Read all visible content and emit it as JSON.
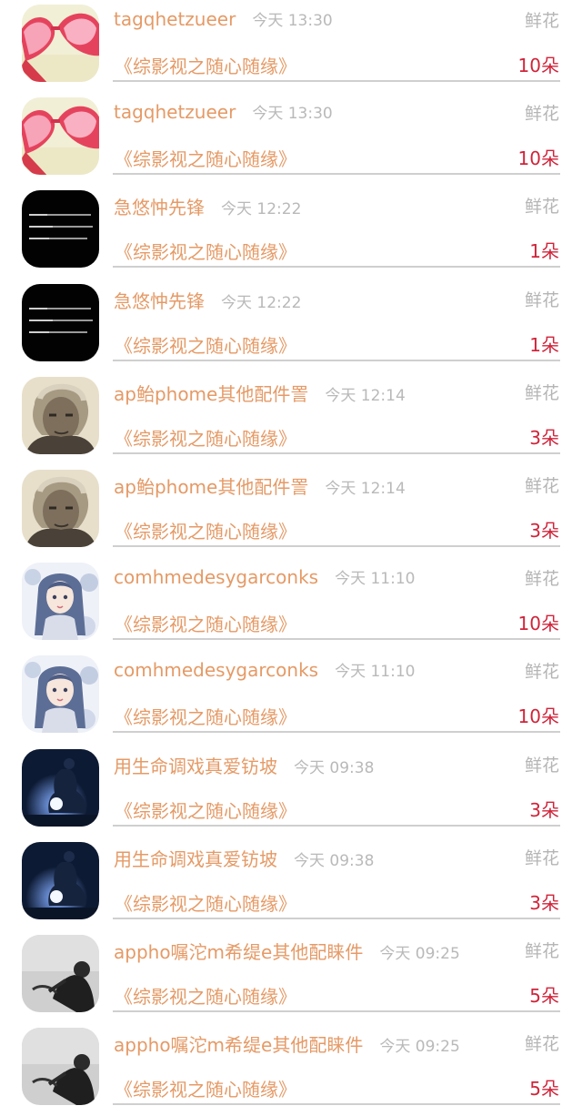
{
  "colors": {
    "name": "#e59a66",
    "time": "#b9b9b9",
    "gift_type": "#b5b5b5",
    "count": "#d0243a",
    "divider": "#cfcfcf"
  },
  "rows": [
    {
      "name": "tagqhetzueer",
      "time": "今天 13:30",
      "gift_type": "鲜花",
      "book": "《综影视之随心随缘》",
      "count": "10朵",
      "avatar": "heart-sunglasses-avatar"
    },
    {
      "name": "tagqhetzueer",
      "time": "今天 13:30",
      "gift_type": "鲜花",
      "book": "《综影视之随心随缘》",
      "count": "10朵",
      "avatar": "heart-sunglasses-avatar"
    },
    {
      "name": "急悠忡先锋",
      "time": "今天 12:22",
      "gift_type": "鲜花",
      "book": "《综影视之随心随缘》",
      "count": "1朵",
      "avatar": "text-quote-avatar"
    },
    {
      "name": "急悠忡先锋",
      "time": "今天 12:22",
      "gift_type": "鲜花",
      "book": "《综影视之随心随缘》",
      "count": "1朵",
      "avatar": "text-quote-avatar"
    },
    {
      "name": "ap鲐phome其他配件詈",
      "time": "今天 12:14",
      "gift_type": "鲜花",
      "book": "《综影视之随心随缘》",
      "count": "3朵",
      "avatar": "old-man-sketch-avatar"
    },
    {
      "name": "ap鲐phome其他配件詈",
      "time": "今天 12:14",
      "gift_type": "鲜花",
      "book": "《综影视之随心随缘》",
      "count": "3朵",
      "avatar": "old-man-sketch-avatar"
    },
    {
      "name": "comhmedesygarconks",
      "time": "今天 11:10",
      "gift_type": "鲜花",
      "book": "《综影视之随心随缘》",
      "count": "10朵",
      "avatar": "anime-girl-avatar"
    },
    {
      "name": "comhmedesygarconks",
      "time": "今天 11:10",
      "gift_type": "鲜花",
      "book": "《综影视之随心随缘》",
      "count": "10朵",
      "avatar": "anime-girl-avatar"
    },
    {
      "name": "用生命调戏真爱钫坡",
      "time": "今天 09:38",
      "gift_type": "鲜花",
      "book": "《综影视之随心随缘》",
      "count": "3朵",
      "avatar": "buddha-night-avatar"
    },
    {
      "name": "用生命调戏真爱钫坡",
      "time": "今天 09:38",
      "gift_type": "鲜花",
      "book": "《综影视之随心随缘》",
      "count": "3朵",
      "avatar": "buddha-night-avatar"
    },
    {
      "name": "appho嘱沱m希缇e其他配睐件",
      "time": "今天 09:25",
      "gift_type": "鲜花",
      "book": "《综影视之随心随缘》",
      "count": "5朵",
      "avatar": "bw-figure-avatar"
    },
    {
      "name": "appho嘱沱m希缇e其他配睐件",
      "time": "今天 09:25",
      "gift_type": "鲜花",
      "book": "《综影视之随心随缘》",
      "count": "5朵",
      "avatar": "bw-figure-avatar"
    }
  ]
}
